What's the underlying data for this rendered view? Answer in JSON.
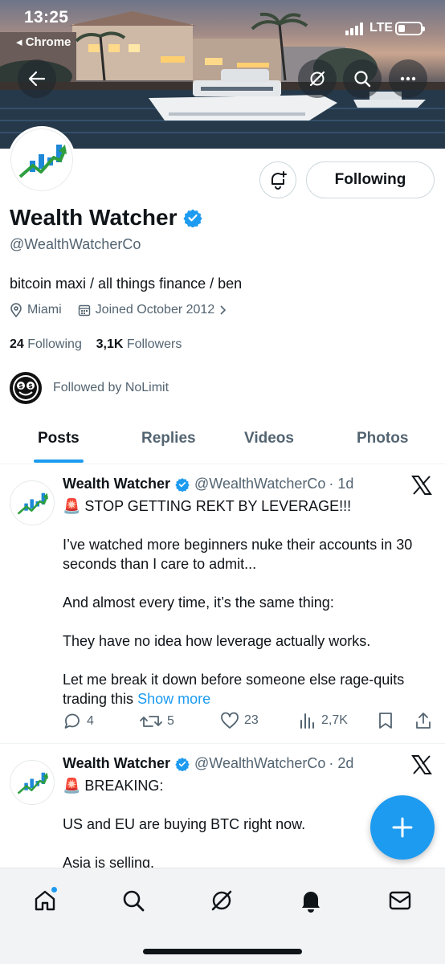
{
  "status_bar": {
    "time": "13:25",
    "back_app": "◂ Chrome",
    "network": "LTE"
  },
  "profile": {
    "name": "Wealth Watcher",
    "handle": "@WealthWatcherCo",
    "bio": "bitcoin maxi / all things finance / ben",
    "location": "Miami",
    "joined": "Joined October 2012",
    "following_count": "24",
    "following_label": "Following",
    "followers_count": "3,1K",
    "followers_label": "Followers",
    "followed_by": "Followed by NoLimit",
    "follow_button": "Following",
    "verified_color": "#1d9bf0"
  },
  "tabs": [
    {
      "label": "Posts",
      "active": true
    },
    {
      "label": "Replies",
      "active": false
    },
    {
      "label": "Videos",
      "active": false
    },
    {
      "label": "Photos",
      "active": false
    }
  ],
  "posts": [
    {
      "author": "Wealth Watcher",
      "handle": "@WealthWatcherCo",
      "time": "· 1d",
      "lines": [
        "🚨 STOP GETTING REKT BY LEVERAGE!!!",
        "I’ve watched more beginners nuke their accounts in 30 seconds than I care to admit...",
        "And almost every time, it’s the same thing:",
        "They have no idea how leverage actually works.",
        "Let me break it down before someone else rage-quits trading this"
      ],
      "show_more": "Show more",
      "replies": "4",
      "reposts": "5",
      "likes": "23",
      "views": "2,7K"
    },
    {
      "author": "Wealth Watcher",
      "handle": "@WealthWatcherCo",
      "time": "· 2d",
      "lines": [
        "🚨 BREAKING:",
        "US and EU are buying BTC right now.",
        "Asia is selling."
      ]
    }
  ],
  "colors": {
    "accent": "#1d9bf0",
    "text": "#0f1419",
    "muted": "#536471",
    "logo_green": "#2e9e3e",
    "logo_blue": "#1e88d8"
  },
  "icons": {
    "back": "arrow-left-icon",
    "grok": "grok-icon",
    "search": "search-icon",
    "more": "more-icon",
    "notify": "bell-plus-icon",
    "fab": "plus-icon"
  }
}
